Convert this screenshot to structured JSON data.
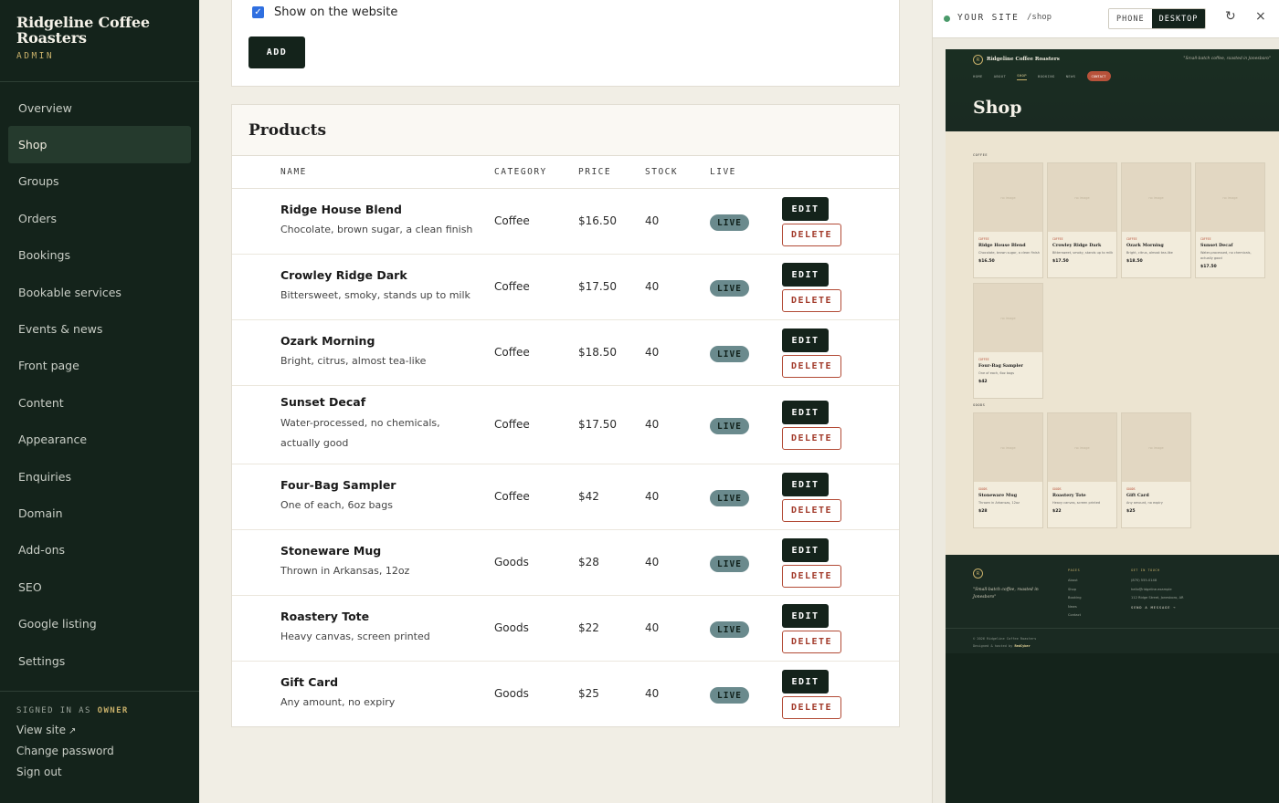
{
  "brand": {
    "name": "Ridgeline Coffee Roasters",
    "sub": "ADMIN"
  },
  "nav": [
    {
      "label": "Overview",
      "key": "overview"
    },
    {
      "label": "Shop",
      "key": "shop",
      "active": true
    },
    {
      "label": "Groups",
      "key": "groups"
    },
    {
      "label": "Orders",
      "key": "orders"
    },
    {
      "label": "Bookings",
      "key": "bookings"
    },
    {
      "label": "Bookable services",
      "key": "bookable-services"
    },
    {
      "label": "Events & news",
      "key": "events-news"
    },
    {
      "label": "Front page",
      "key": "front-page"
    },
    {
      "label": "Content",
      "key": "content"
    },
    {
      "label": "Appearance",
      "key": "appearance"
    },
    {
      "label": "Enquiries",
      "key": "enquiries"
    },
    {
      "label": "Domain",
      "key": "domain"
    },
    {
      "label": "Add-ons",
      "key": "add-ons"
    },
    {
      "label": "SEO",
      "key": "seo"
    },
    {
      "label": "Google listing",
      "key": "google-listing"
    },
    {
      "label": "Settings",
      "key": "settings"
    }
  ],
  "account": {
    "signed_prefix": "SIGNED IN AS",
    "role": "OWNER",
    "view_site": "View site",
    "view_site_icon": "↗",
    "change_password": "Change password",
    "sign_out": "Sign out"
  },
  "form": {
    "show_label": "Show on the website",
    "show_checked": true,
    "add_label": "ADD"
  },
  "products": {
    "title": "Products",
    "columns": {
      "name": "NAME",
      "category": "CATEGORY",
      "price": "PRICE",
      "stock": "STOCK",
      "live": "LIVE"
    },
    "edit_label": "EDIT",
    "delete_label": "DELETE",
    "rows": [
      {
        "name": "Ridge House Blend",
        "desc": "Chocolate, brown sugar, a clean finish",
        "category": "Coffee",
        "price": "$16.50",
        "stock": "40",
        "status": "LIVE"
      },
      {
        "name": "Crowley Ridge Dark",
        "desc": "Bittersweet, smoky, stands up to milk",
        "category": "Coffee",
        "price": "$17.50",
        "stock": "40",
        "status": "LIVE"
      },
      {
        "name": "Ozark Morning",
        "desc": "Bright, citrus, almost tea-like",
        "category": "Coffee",
        "price": "$18.50",
        "stock": "40",
        "status": "LIVE"
      },
      {
        "name": "Sunset Decaf",
        "desc": "Water-processed, no chemicals, actually good",
        "category": "Coffee",
        "price": "$17.50",
        "stock": "40",
        "status": "LIVE"
      },
      {
        "name": "Four-Bag Sampler",
        "desc": "One of each, 6oz bags",
        "category": "Coffee",
        "price": "$42",
        "stock": "40",
        "status": "LIVE"
      },
      {
        "name": "Stoneware Mug",
        "desc": "Thrown in Arkansas, 12oz",
        "category": "Goods",
        "price": "$28",
        "stock": "40",
        "status": "LIVE"
      },
      {
        "name": "Roastery Tote",
        "desc": "Heavy canvas, screen printed",
        "category": "Goods",
        "price": "$22",
        "stock": "40",
        "status": "LIVE"
      },
      {
        "name": "Gift Card",
        "desc": "Any amount, no expiry",
        "category": "Goods",
        "price": "$25",
        "stock": "40",
        "status": "LIVE"
      }
    ]
  },
  "preview": {
    "label": "YOUR SITE",
    "path": "/shop",
    "phone": "PHONE",
    "desktop": "DESKTOP",
    "desktop_selected": true,
    "refresh_icon": "↻",
    "close_icon": "×",
    "site": {
      "logo": "R",
      "name": "Ridgeline Coffee Roasters",
      "tagline": "\"Small-batch coffee, roasted in Jonesboro\"",
      "nav": [
        "HOME",
        "ABOUT",
        "SHOP",
        "BOOKING",
        "NEWS"
      ],
      "nav_current": "SHOP",
      "contact": "CONTACT",
      "title": "Shop",
      "coffee_label": "COFFEE",
      "goods_label": "GOODS",
      "no_image": "no image",
      "coffee_cat": "COFFEE",
      "goods_cat": "GOODS",
      "coffee_items": [
        {
          "name": "Ridge House Blend",
          "desc": "Chocolate, brown sugar, a clean finish",
          "price": "$16.50"
        },
        {
          "name": "Crowley Ridge Dark",
          "desc": "Bittersweet, smoky, stands up to milk",
          "price": "$17.50"
        },
        {
          "name": "Ozark Morning",
          "desc": "Bright, citrus, almost tea-like",
          "price": "$18.50"
        },
        {
          "name": "Sunset Decaf",
          "desc": "Water-processed, no chemicals, actually good",
          "price": "$17.50"
        },
        {
          "name": "Four-Bag Sampler",
          "desc": "One of each, 6oz bags",
          "price": "$42"
        }
      ],
      "goods_items": [
        {
          "name": "Stoneware Mug",
          "desc": "Thrown in Arkansas, 12oz",
          "price": "$28"
        },
        {
          "name": "Roastery Tote",
          "desc": "Heavy canvas, screen printed",
          "price": "$22"
        },
        {
          "name": "Gift Card",
          "desc": "Any amount, no expiry",
          "price": "$25"
        }
      ],
      "footer": {
        "quote": "\"Small-batch coffee, roasted in Jonesboro\"",
        "pages_heading": "PAGES",
        "pages": [
          "About",
          "Shop",
          "Booking",
          "News",
          "Contact"
        ],
        "contact_heading": "GET IN TOUCH",
        "phone": "(870) 555-0148",
        "email": "hello@ridgeline.example",
        "address": "112 Ridge Street, Jonesboro, AR",
        "send": "SEND A MESSAGE →",
        "copyright": "© 2026 Ridgeline Coffee Roasters",
        "credit_prefix": "Designed & hosted by",
        "credit_name": "RedCyber"
      }
    }
  }
}
